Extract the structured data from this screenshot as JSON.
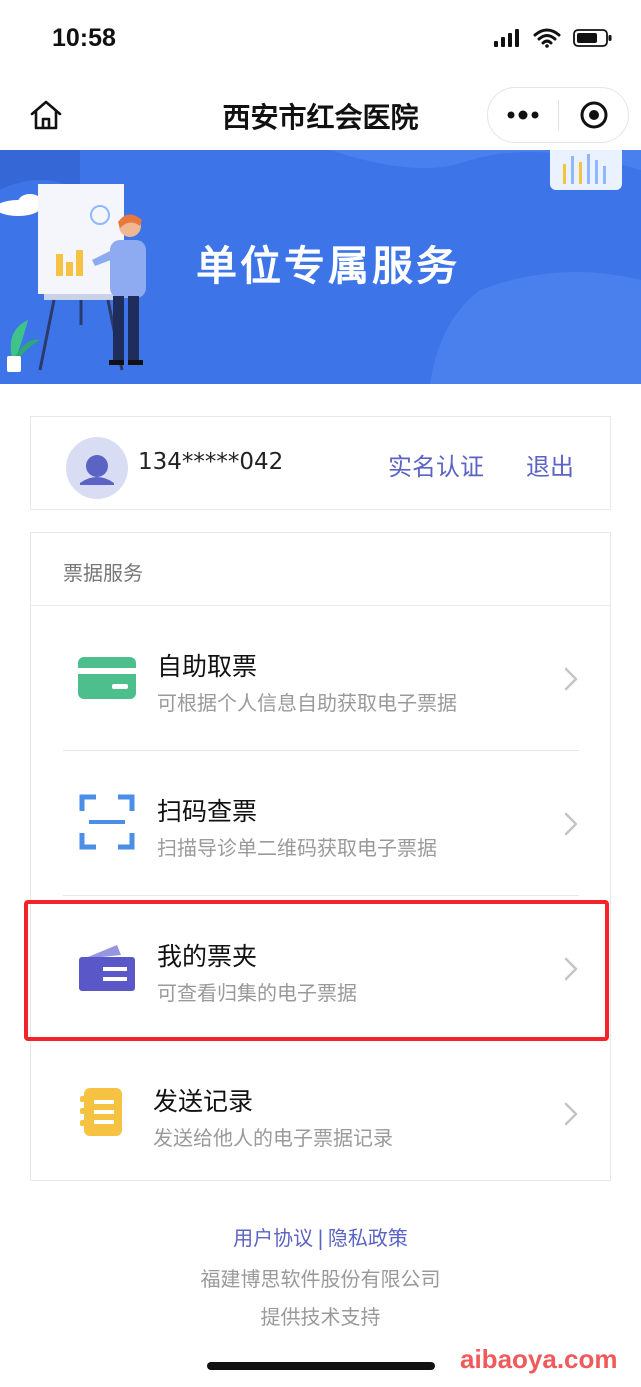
{
  "status_bar": {
    "time": "10:58",
    "icons": [
      "signal-icon",
      "wifi-icon",
      "battery-icon"
    ]
  },
  "nav_bar": {
    "title": "西安市红会医院",
    "home_icon": "home-icon",
    "more_icon": "more-dots-icon",
    "close_icon": "target-close-icon"
  },
  "banner": {
    "title": "单位专属服务",
    "background_color": "#3d74e8"
  },
  "user": {
    "phone": "134*****042",
    "verify_label": "实名认证",
    "logout_label": "退出"
  },
  "services": {
    "section_title": "票据服务",
    "items": [
      {
        "name": "自助取票",
        "description": "可根据个人信息自助获取电子票据",
        "icon": "card-icon",
        "icon_color": "#4dbf8c"
      },
      {
        "name": "扫码查票",
        "description": "扫描导诊单二维码获取电子票据",
        "icon": "scan-icon",
        "icon_color": "#4a8ee8"
      },
      {
        "name": "我的票夹",
        "description": "可查看归集的电子票据",
        "icon": "ticket-folder-icon",
        "icon_color": "#5a58c9"
      },
      {
        "name": "发送记录",
        "description": "发送给他人的电子票据记录",
        "icon": "record-icon",
        "icon_color": "#f5c242"
      }
    ]
  },
  "footer": {
    "user_agreement": "用户协议",
    "separator": "|",
    "privacy_policy": "隐私政策",
    "company": "福建博思软件股份有限公司",
    "support": "提供技术支持"
  },
  "watermark": "aibaoya.com",
  "highlight_color": "#f2242a",
  "accent_color": "#5b63c4"
}
